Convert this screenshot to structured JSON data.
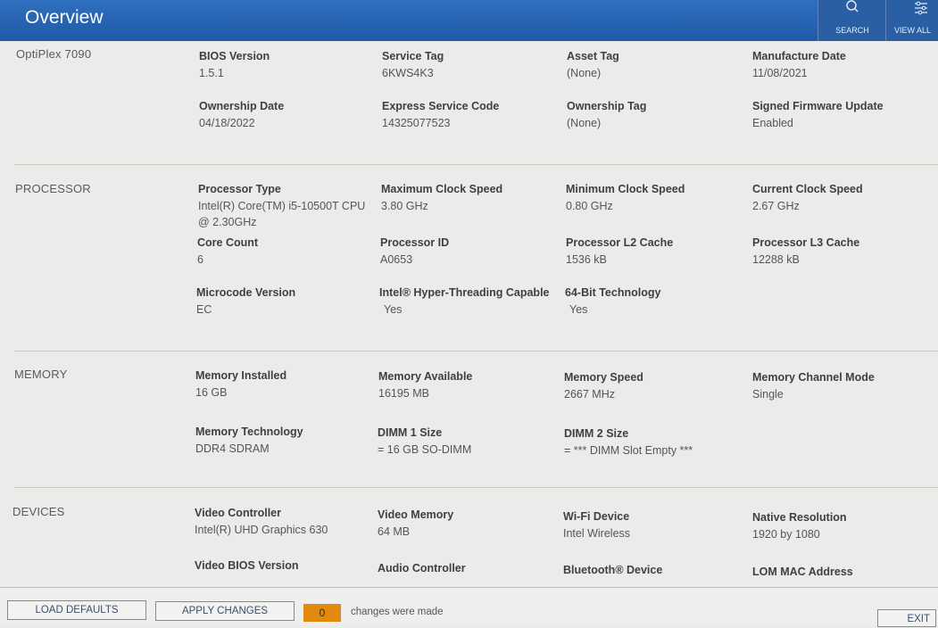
{
  "header": {
    "title": "Overview",
    "search_label": "SEARCH",
    "view_all_label": "VIEW ALL"
  },
  "system": {
    "label": "OptiPlex 7090",
    "fields": [
      {
        "key": "BIOS Version",
        "value": "1.5.1"
      },
      {
        "key": "Service Tag",
        "value": "6KWS4K3"
      },
      {
        "key": "Asset Tag",
        "value": "(None)"
      },
      {
        "key": "Manufacture Date",
        "value": "11/08/2021"
      },
      {
        "key": "Ownership Date",
        "value": "04/18/2022"
      },
      {
        "key": "Express Service Code",
        "value": "14325077523"
      },
      {
        "key": "Ownership Tag",
        "value": "(None)"
      },
      {
        "key": "Signed Firmware Update",
        "value": "Enabled"
      }
    ]
  },
  "processor": {
    "label": "PROCESSOR",
    "fields": [
      {
        "key": "Processor Type",
        "value": "Intel(R) Core(TM) i5-10500T CPU @ 2.30GHz"
      },
      {
        "key": "Maximum Clock Speed",
        "value": "3.80 GHz"
      },
      {
        "key": "Minimum Clock Speed",
        "value": "0.80 GHz"
      },
      {
        "key": "Current Clock Speed",
        "value": "2.67 GHz"
      },
      {
        "key": "Core Count",
        "value": "6"
      },
      {
        "key": "Processor ID",
        "value": "A0653"
      },
      {
        "key": "Processor L2 Cache",
        "value": "1536 kB"
      },
      {
        "key": "Processor L3 Cache",
        "value": "12288 kB"
      },
      {
        "key": "Microcode Version",
        "value": "EC"
      },
      {
        "key": "Intel® Hyper-Threading Capable",
        "value": "Yes"
      },
      {
        "key": "64-Bit Technology",
        "value": "Yes"
      }
    ]
  },
  "memory": {
    "label": "MEMORY",
    "fields": [
      {
        "key": "Memory Installed",
        "value": "16 GB"
      },
      {
        "key": "Memory Available",
        "value": "16195 MB"
      },
      {
        "key": "Memory Speed",
        "value": "2667 MHz"
      },
      {
        "key": "Memory Channel Mode",
        "value": "Single"
      },
      {
        "key": "Memory Technology",
        "value": "DDR4 SDRAM"
      },
      {
        "key": "DIMM 1 Size",
        "value": "= 16 GB SO-DIMM"
      },
      {
        "key": "DIMM 2 Size",
        "value": "= *** DIMM Slot Empty ***"
      }
    ]
  },
  "devices": {
    "label": "DEVICES",
    "fields": [
      {
        "key": "Video Controller",
        "value": "Intel(R) UHD Graphics 630"
      },
      {
        "key": "Video Memory",
        "value": "64 MB"
      },
      {
        "key": "Wi-Fi Device",
        "value": "Intel Wireless"
      },
      {
        "key": "Native Resolution",
        "value": "1920 by 1080"
      },
      {
        "key": "Video BIOS Version",
        "value": ""
      },
      {
        "key": "Audio Controller",
        "value": ""
      },
      {
        "key": "Bluetooth® Device",
        "value": ""
      },
      {
        "key": "LOM MAC Address",
        "value": ""
      }
    ]
  },
  "footer": {
    "load_defaults": "LOAD DEFAULTS",
    "apply_changes": "APPLY CHANGES",
    "changes_count": "0",
    "changes_text": "changes were made",
    "exit": "EXIT"
  }
}
